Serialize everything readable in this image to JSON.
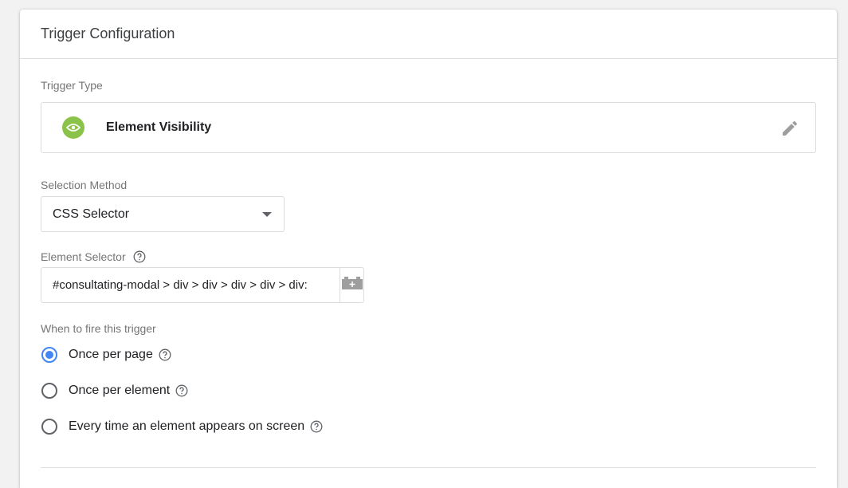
{
  "header": {
    "title": "Trigger Configuration"
  },
  "trigger_type": {
    "label": "Trigger Type",
    "name": "Element Visibility",
    "icon": "eye-icon",
    "icon_color": "#8bc34a"
  },
  "selection_method": {
    "label": "Selection Method",
    "value": "CSS Selector"
  },
  "element_selector": {
    "label": "Element Selector",
    "value": "#consultating-modal > div > div > div > div > div:"
  },
  "fire": {
    "label": "When to fire this trigger",
    "options": [
      {
        "label": "Once per page",
        "checked": true
      },
      {
        "label": "Once per element",
        "checked": false
      },
      {
        "label": "Every time an element appears on screen",
        "checked": false
      }
    ]
  },
  "colors": {
    "accent": "#4285f4",
    "border": "#dadce0",
    "muted_text": "#757575"
  }
}
